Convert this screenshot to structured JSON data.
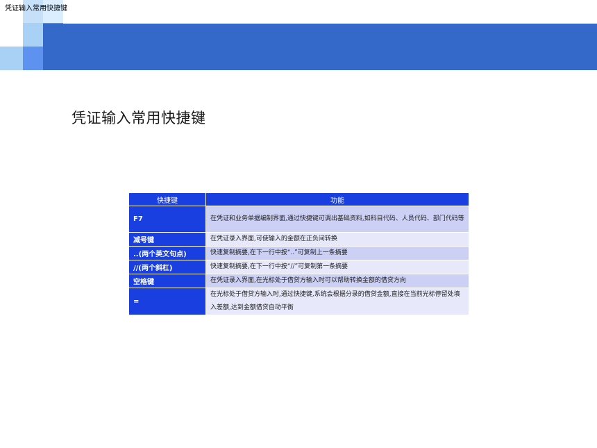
{
  "header": {
    "caption": "凭证输入常用快捷键"
  },
  "page": {
    "title": "凭证输入常用快捷键"
  },
  "table": {
    "columns": [
      "快捷键",
      "功能"
    ],
    "rows": [
      {
        "key": "F7",
        "desc": "在凭证和业务单据编制界面,通过快捷键可调出基础资料,如科目代码、人员代码、部门代码等"
      },
      {
        "key": "减号键",
        "desc": "在凭证录入界面,可使输入的金额在正负间转换"
      },
      {
        "key": "..(两个英文句点)",
        "desc": "快速复制摘要,在下一行中按“..”可复制上一条摘要"
      },
      {
        "key": "//(两个斜杠)",
        "desc": "快速复制摘要,在下一行中按“//”可复制第一条摘要"
      },
      {
        "key": "空格键",
        "desc": "在凭证录入界面,在光标处于借贷方输入时可以帮助转换金额的借贷方向"
      },
      {
        "key": "=",
        "desc": "在光标处于借贷方输入时,通过快捷键,系统会根据分录的借贷金额,直接在当前光标停留处填入差额,达到金额借贷自动平衡"
      }
    ]
  },
  "colors": {
    "banner": "#3468c9",
    "table_header": "#1a3fe0",
    "row_odd": "#ccd0f5",
    "row_even": "#e7e9fa"
  }
}
